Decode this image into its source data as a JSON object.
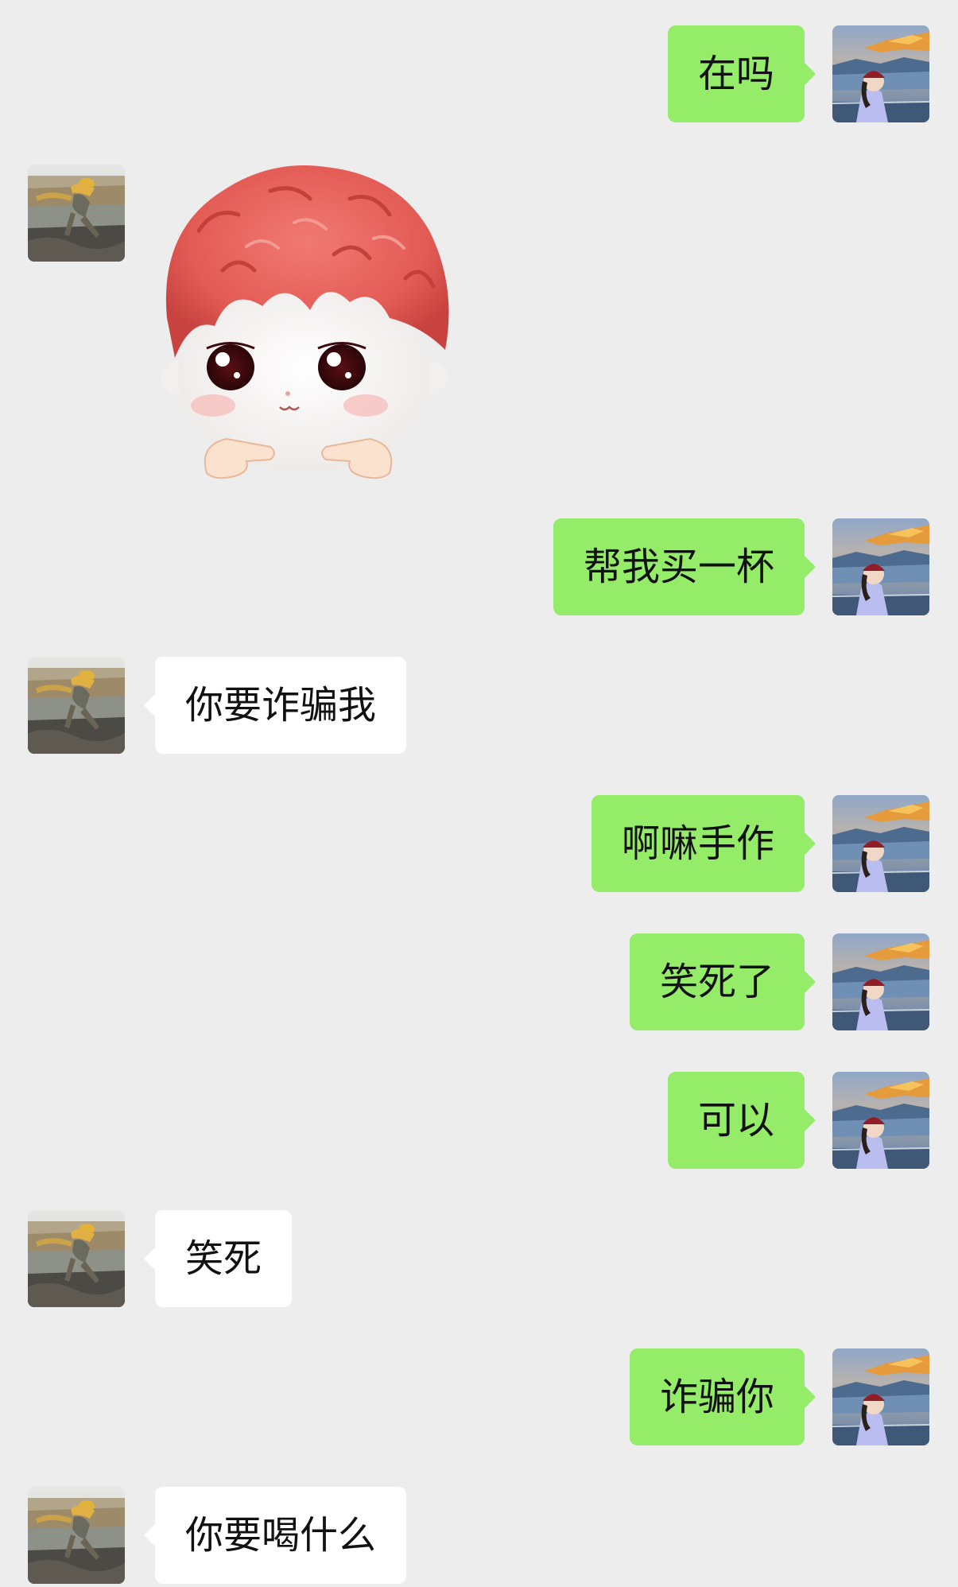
{
  "colors": {
    "background": "#ededed",
    "self_bubble": "#95ec69",
    "other_bubble": "#ffffff",
    "text": "#111111"
  },
  "messages": [
    {
      "sender": "self",
      "type": "text",
      "text": "在吗"
    },
    {
      "sender": "other",
      "type": "sticker",
      "sticker": "red-haired-plush-doll-pointing-fingers"
    },
    {
      "sender": "self",
      "type": "text",
      "text": "帮我买一杯"
    },
    {
      "sender": "other",
      "type": "text",
      "text": "你要诈骗我"
    },
    {
      "sender": "self",
      "type": "text",
      "text": "啊嘛手作"
    },
    {
      "sender": "self",
      "type": "text",
      "text": "笑死了"
    },
    {
      "sender": "self",
      "type": "text",
      "text": "可以"
    },
    {
      "sender": "other",
      "type": "text",
      "text": "笑死"
    },
    {
      "sender": "self",
      "type": "text",
      "text": "诈骗你"
    },
    {
      "sender": "other",
      "type": "text",
      "text": "你要喝什么"
    }
  ],
  "avatars": {
    "self": "avatar-person-in-red-hat-mountain-sunset",
    "other": "avatar-person-jumping-riverbank"
  }
}
